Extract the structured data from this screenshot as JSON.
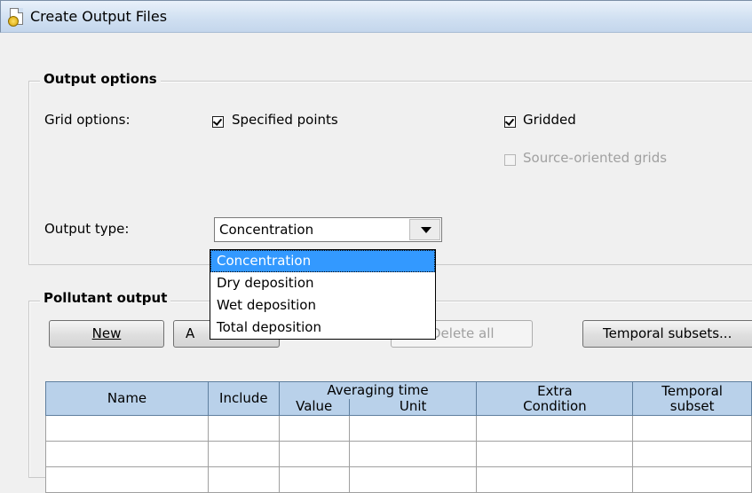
{
  "window": {
    "title": "Create Output Files"
  },
  "output_options": {
    "group_title": "Output options",
    "grid_options_label": "Grid options:",
    "specified_points": {
      "label": "Specified points",
      "checked": true
    },
    "gridded": {
      "label": "Gridded",
      "checked": true
    },
    "source_oriented_grids": {
      "label": "Source-oriented grids",
      "checked": false,
      "enabled": false
    },
    "output_type_label": "Output type:",
    "output_type_value": "Concentration",
    "output_type_options": [
      "Concentration",
      "Dry deposition",
      "Wet deposition",
      "Total deposition"
    ]
  },
  "pollutant_output": {
    "group_title": "Pollutant output",
    "buttons": {
      "new_label": "New",
      "add_partial": "A",
      "delete_all_label": "Delete all",
      "temporal_subsets_label": "Temporal subsets..."
    },
    "table": {
      "headers": {
        "name": "Name",
        "include": "Include",
        "averaging_time": "Averaging time",
        "value": "Value",
        "unit": "Unit",
        "extra_condition_1": "Extra",
        "extra_condition_2": "Condition",
        "temporal_subset_1": "Temporal",
        "temporal_subset_2": "subset"
      }
    }
  }
}
